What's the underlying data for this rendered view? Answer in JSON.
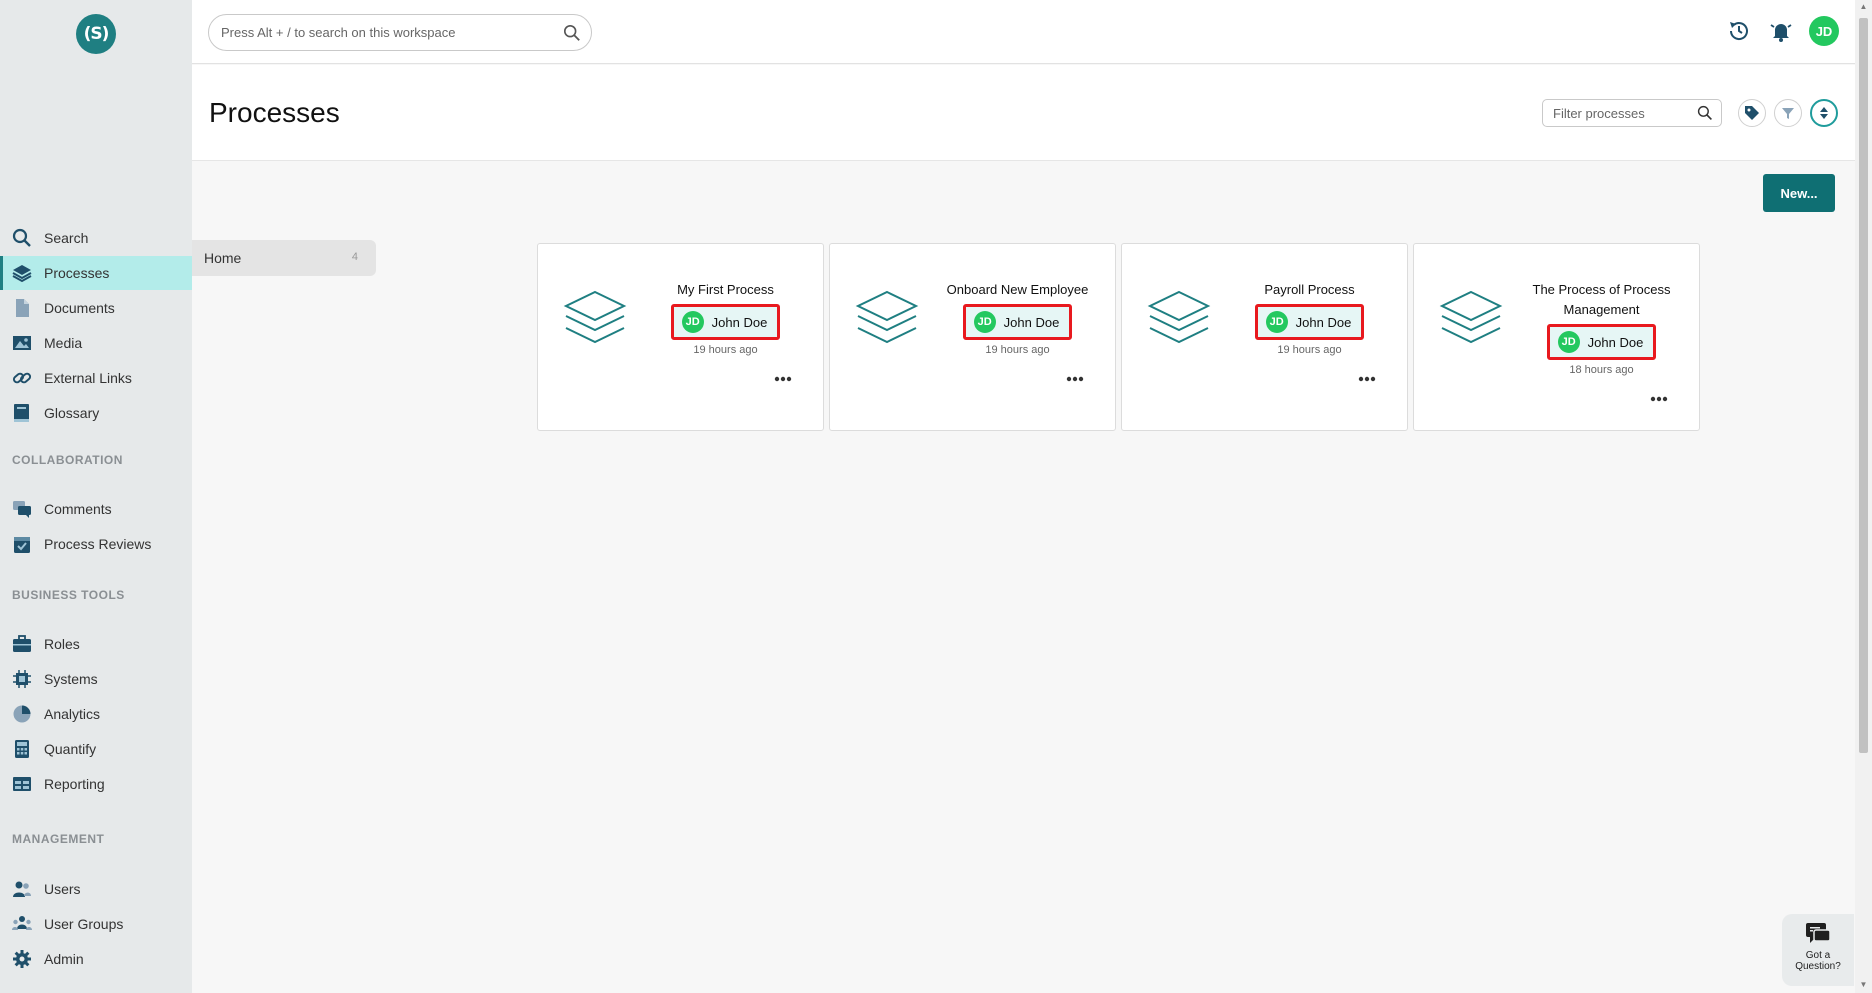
{
  "logo": {
    "text": "(S)"
  },
  "search": {
    "placeholder": "Press Alt + / to search on this workspace"
  },
  "user": {
    "initials": "JD",
    "name": "John Doe"
  },
  "sidebar": {
    "items": [
      {
        "label": "Search",
        "icon": "search-icon"
      },
      {
        "label": "Processes",
        "icon": "layers-icon",
        "active": true
      },
      {
        "label": "Documents",
        "icon": "document-icon"
      },
      {
        "label": "Media",
        "icon": "image-icon"
      },
      {
        "label": "External Links",
        "icon": "link-icon"
      },
      {
        "label": "Glossary",
        "icon": "book-icon"
      }
    ],
    "collaboration_title": "COLLABORATION",
    "collaboration": [
      {
        "label": "Comments",
        "icon": "comments-icon"
      },
      {
        "label": "Process Reviews",
        "icon": "calendar-check-icon"
      }
    ],
    "business_title": "BUSINESS TOOLS",
    "business": [
      {
        "label": "Roles",
        "icon": "briefcase-icon"
      },
      {
        "label": "Systems",
        "icon": "chip-icon"
      },
      {
        "label": "Analytics",
        "icon": "pie-chart-icon"
      },
      {
        "label": "Quantify",
        "icon": "calculator-icon"
      },
      {
        "label": "Reporting",
        "icon": "table-icon"
      }
    ],
    "management_title": "MANAGEMENT",
    "management": [
      {
        "label": "Users",
        "icon": "users-icon"
      },
      {
        "label": "User Groups",
        "icon": "user-groups-icon"
      },
      {
        "label": "Admin",
        "icon": "gear-icon"
      }
    ]
  },
  "page": {
    "title": "Processes"
  },
  "filter": {
    "placeholder": "Filter processes"
  },
  "toolbar": {
    "new_label": "New..."
  },
  "folder": {
    "name": "Home",
    "count": "4"
  },
  "processes": [
    {
      "title": "My First Process",
      "owner": "John Doe",
      "owner_initials": "JD",
      "time": "19 hours ago"
    },
    {
      "title": "Onboard New Employee",
      "owner": "John Doe",
      "owner_initials": "JD",
      "time": "19 hours ago"
    },
    {
      "title": "Payroll Process",
      "owner": "John Doe",
      "owner_initials": "JD",
      "time": "19 hours ago"
    },
    {
      "title": "The Process of Process Management",
      "owner": "John Doe",
      "owner_initials": "JD",
      "time": "18 hours ago"
    }
  ],
  "help": {
    "label": "Got a Question?"
  },
  "colors": {
    "accent": "#1f7f82",
    "primary_button": "#0f6f73",
    "avatar": "#23c85f",
    "highlight": "#e8191e",
    "active_nav": "#b3ecea"
  }
}
